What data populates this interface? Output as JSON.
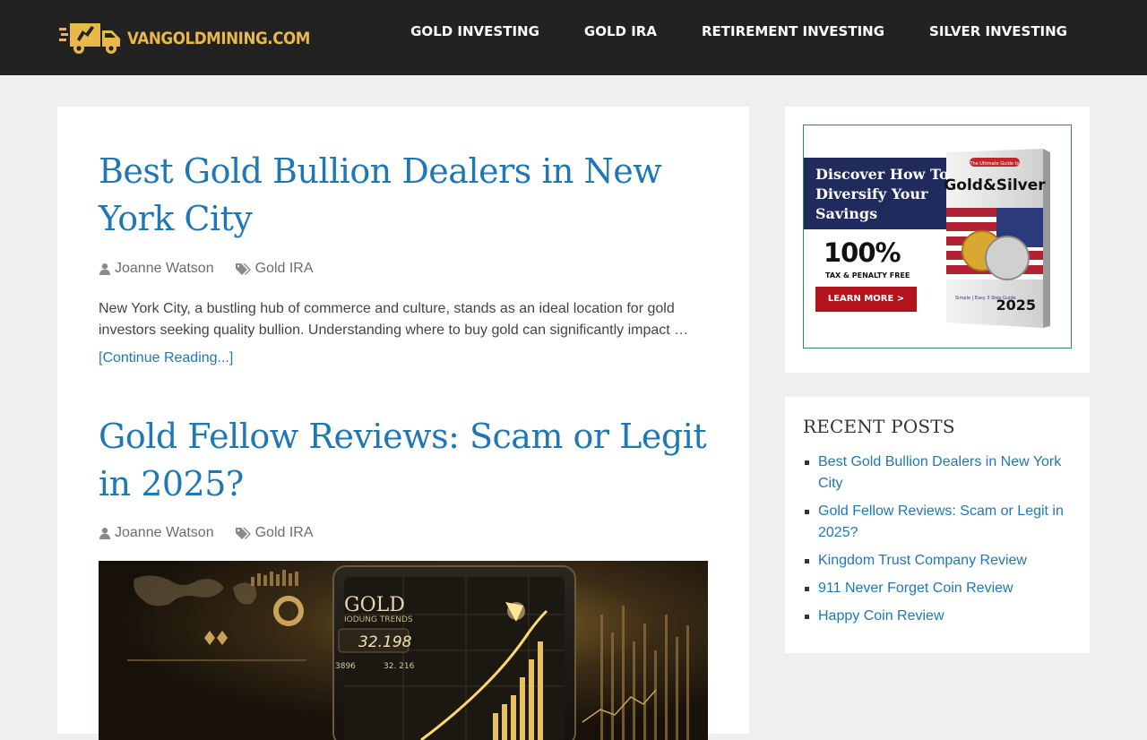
{
  "header": {
    "logo_text": "VANGOLDMINING.COM",
    "nav": [
      {
        "label": "GOLD INVESTING"
      },
      {
        "label": "GOLD IRA"
      },
      {
        "label": "RETIREMENT INVESTING"
      },
      {
        "label": "SILVER INVESTING"
      }
    ]
  },
  "posts": [
    {
      "title": "Best Gold Bullion Dealers in New York City",
      "author": "Joanne Watson",
      "category": "Gold IRA",
      "excerpt": "New York City, a bustling hub of commerce and culture, stands as an ideal location for gold investors seeking quality bullion. Understanding where to buy gold can significantly impact …",
      "continue_label": "[Continue Reading...]"
    },
    {
      "title": "Gold Fellow Reviews: Scam or Legit in 2025?",
      "author": "Joanne Watson",
      "category": "Gold IRA",
      "image_text": {
        "title": "GOLD",
        "subtitle": "IODUNG TRENDS",
        "price": "32.198",
        "stat1": "3896",
        "stat2": "32. 216"
      }
    }
  ],
  "ad": {
    "headline": "Discover How To Diversify Your Savings",
    "big_text": "100%",
    "small_text": "TAX & PENALTY FREE",
    "cta": "LEARN MORE >",
    "book_kicker": "The Ultimate Guide to",
    "book_title": "Gold&Silver",
    "book_tag": "Simple | Easy 3 Step Guide",
    "book_year": "2025"
  },
  "sidebar": {
    "recent_title": "RECENT POSTS",
    "recent_posts": [
      {
        "label": "Best Gold Bullion Dealers in New York City"
      },
      {
        "label": "Gold Fellow Reviews: Scam or Legit in 2025?"
      },
      {
        "label": "Kingdom Trust Company Review"
      },
      {
        "label": "911 Never Forget Coin Review"
      },
      {
        "label": "Happy Coin Review"
      }
    ]
  },
  "colors": {
    "accent_link": "#1f78b4",
    "header_bg": "#222222",
    "logo_gold": "#e8b84a",
    "cta_red": "#b3141c"
  }
}
